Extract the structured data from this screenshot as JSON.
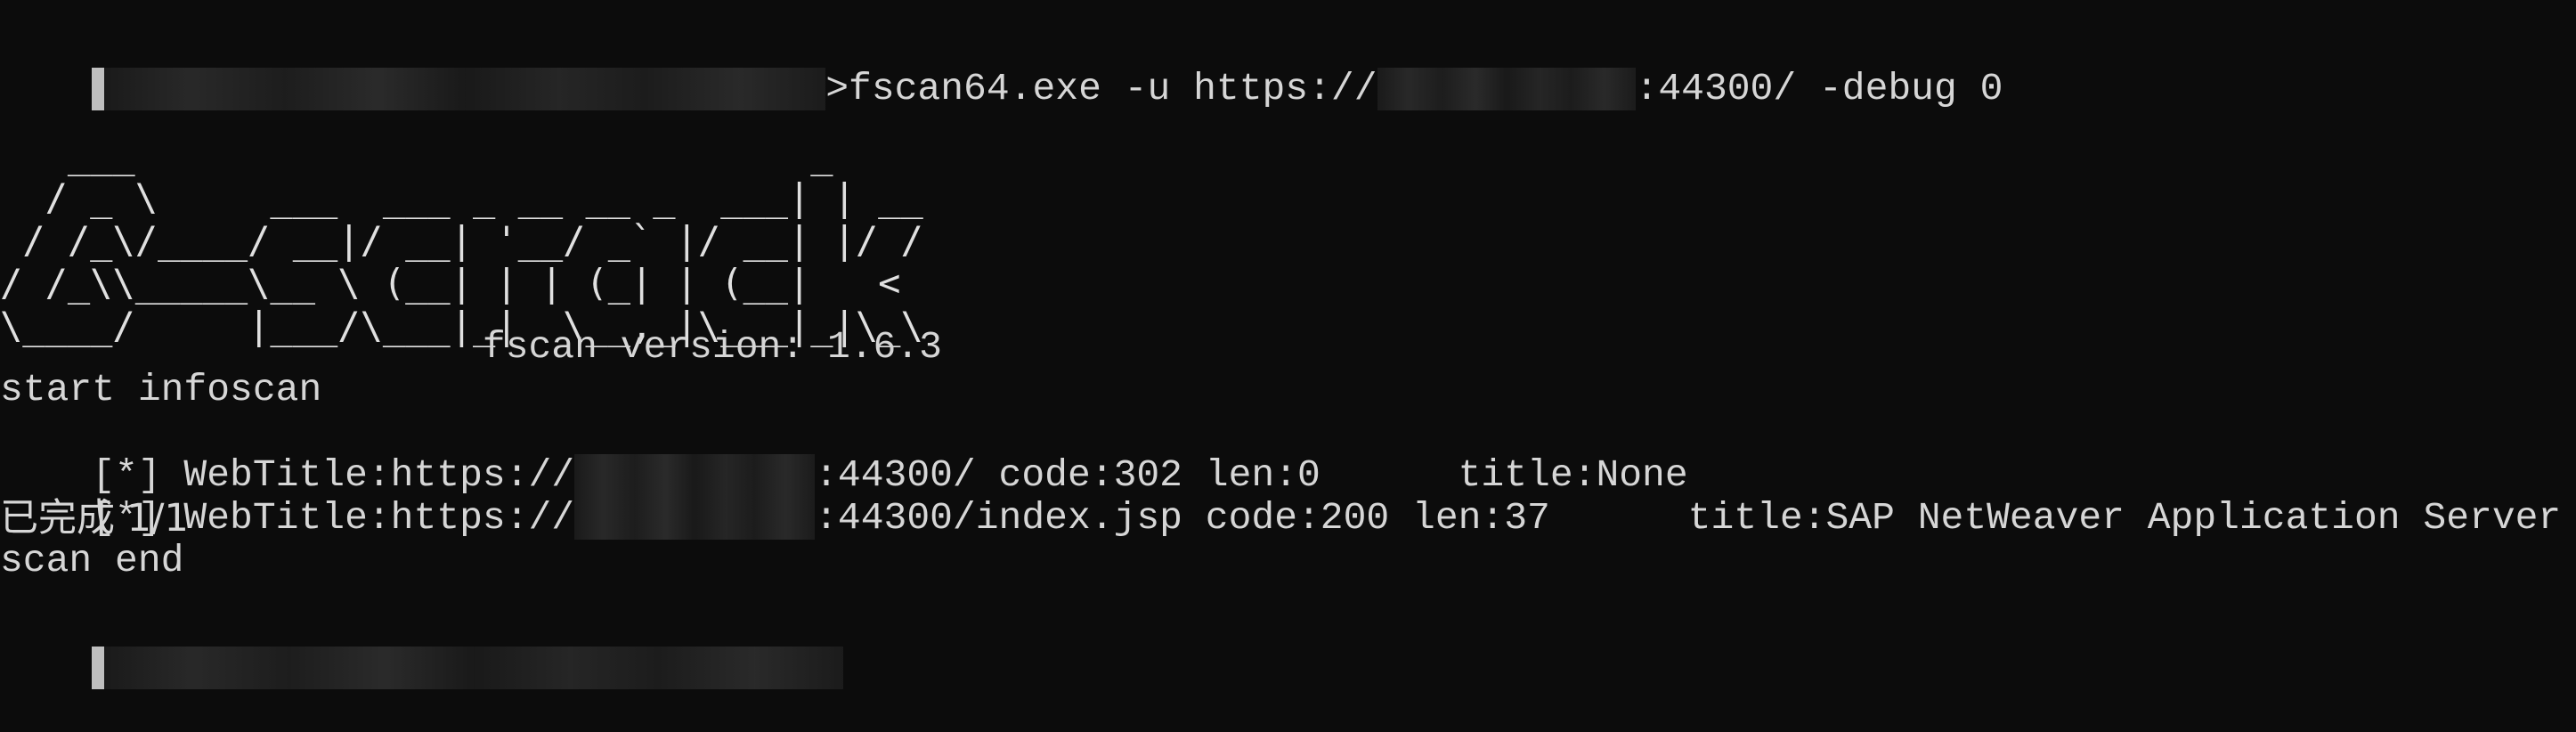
{
  "prompt_line": {
    "command_prefix": ">fscan64.exe -u https://",
    "command_suffix": ":44300/ -debug 0"
  },
  "banner": {
    "ascii_art": "   ___                              _\n  / _ \\     ___  ___ _ __ __ _  ___| | __\n / /_\\/____/ __|/ __| '__/ _` |/ __| |/ /\n/ /_\\\\_____\\__ \\ (__| | | (_| | (__|   <\n\\____/     |___/\\___|_|  \\__,_|\\___|_|\\_\\",
    "version": "                     fscan version: 1.6.3"
  },
  "output": {
    "start": "start infoscan",
    "results": [
      {
        "prefix": "[*] WebTitle:https://",
        "suffix": ":44300/ code:302 len:0      title:None"
      },
      {
        "prefix": "[*] WebTitle:https://",
        "suffix": ":44300/index.jsp code:200 len:37      title:SAP NetWeaver Application Server Java"
      }
    ],
    "progress": "已完成 1/1",
    "end": "scan end"
  }
}
